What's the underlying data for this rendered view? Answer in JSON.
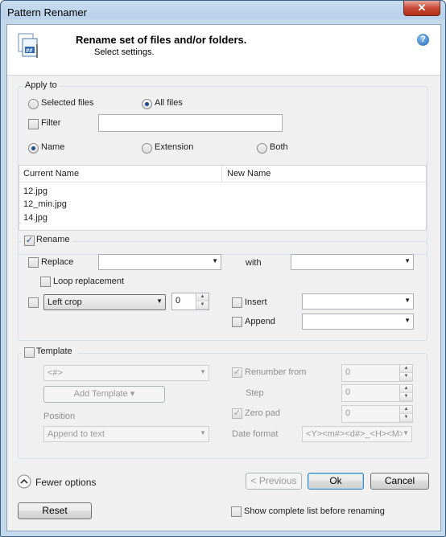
{
  "window": {
    "title": "Pattern Renamer",
    "close_glyph": "✕"
  },
  "header": {
    "title": "Rename set of files and/or folders.",
    "subtitle": "Select settings.",
    "icon": "rename-files-icon",
    "help": "?"
  },
  "apply_to": {
    "label": "Apply to",
    "selected_files": "Selected files",
    "all_files": "All files",
    "filter": "Filter",
    "filter_value": "",
    "name": "Name",
    "extension": "Extension",
    "both": "Both"
  },
  "file_list": {
    "columns": [
      "Current Name",
      "New Name"
    ],
    "rows": [
      "12.jpg",
      "12_min.jpg",
      "14.jpg"
    ]
  },
  "rename": {
    "label": "Rename",
    "checked": true,
    "replace": "Replace",
    "with": "with",
    "loop_replacement": "Loop replacement",
    "crop_mode": "Left crop",
    "crop_count": "0",
    "insert": "Insert",
    "append": "Append"
  },
  "template": {
    "label": "Template",
    "pattern": "<#>",
    "add_template": "Add Template ▾",
    "position_label": "Position",
    "position_value": "Append to text",
    "renumber_from": "Renumber from",
    "renumber_value": "0",
    "step": "Step",
    "step_value": "0",
    "zero_pad": "Zero pad",
    "zero_pad_value": "0",
    "date_format": "Date format",
    "date_format_value": "<Y><m#><d#>_<H><M>"
  },
  "footer": {
    "fewer_options": "Fewer options",
    "previous": "< Previous",
    "ok": "Ok",
    "cancel": "Cancel",
    "reset": "Reset",
    "show_complete_list": "Show complete list before renaming"
  }
}
